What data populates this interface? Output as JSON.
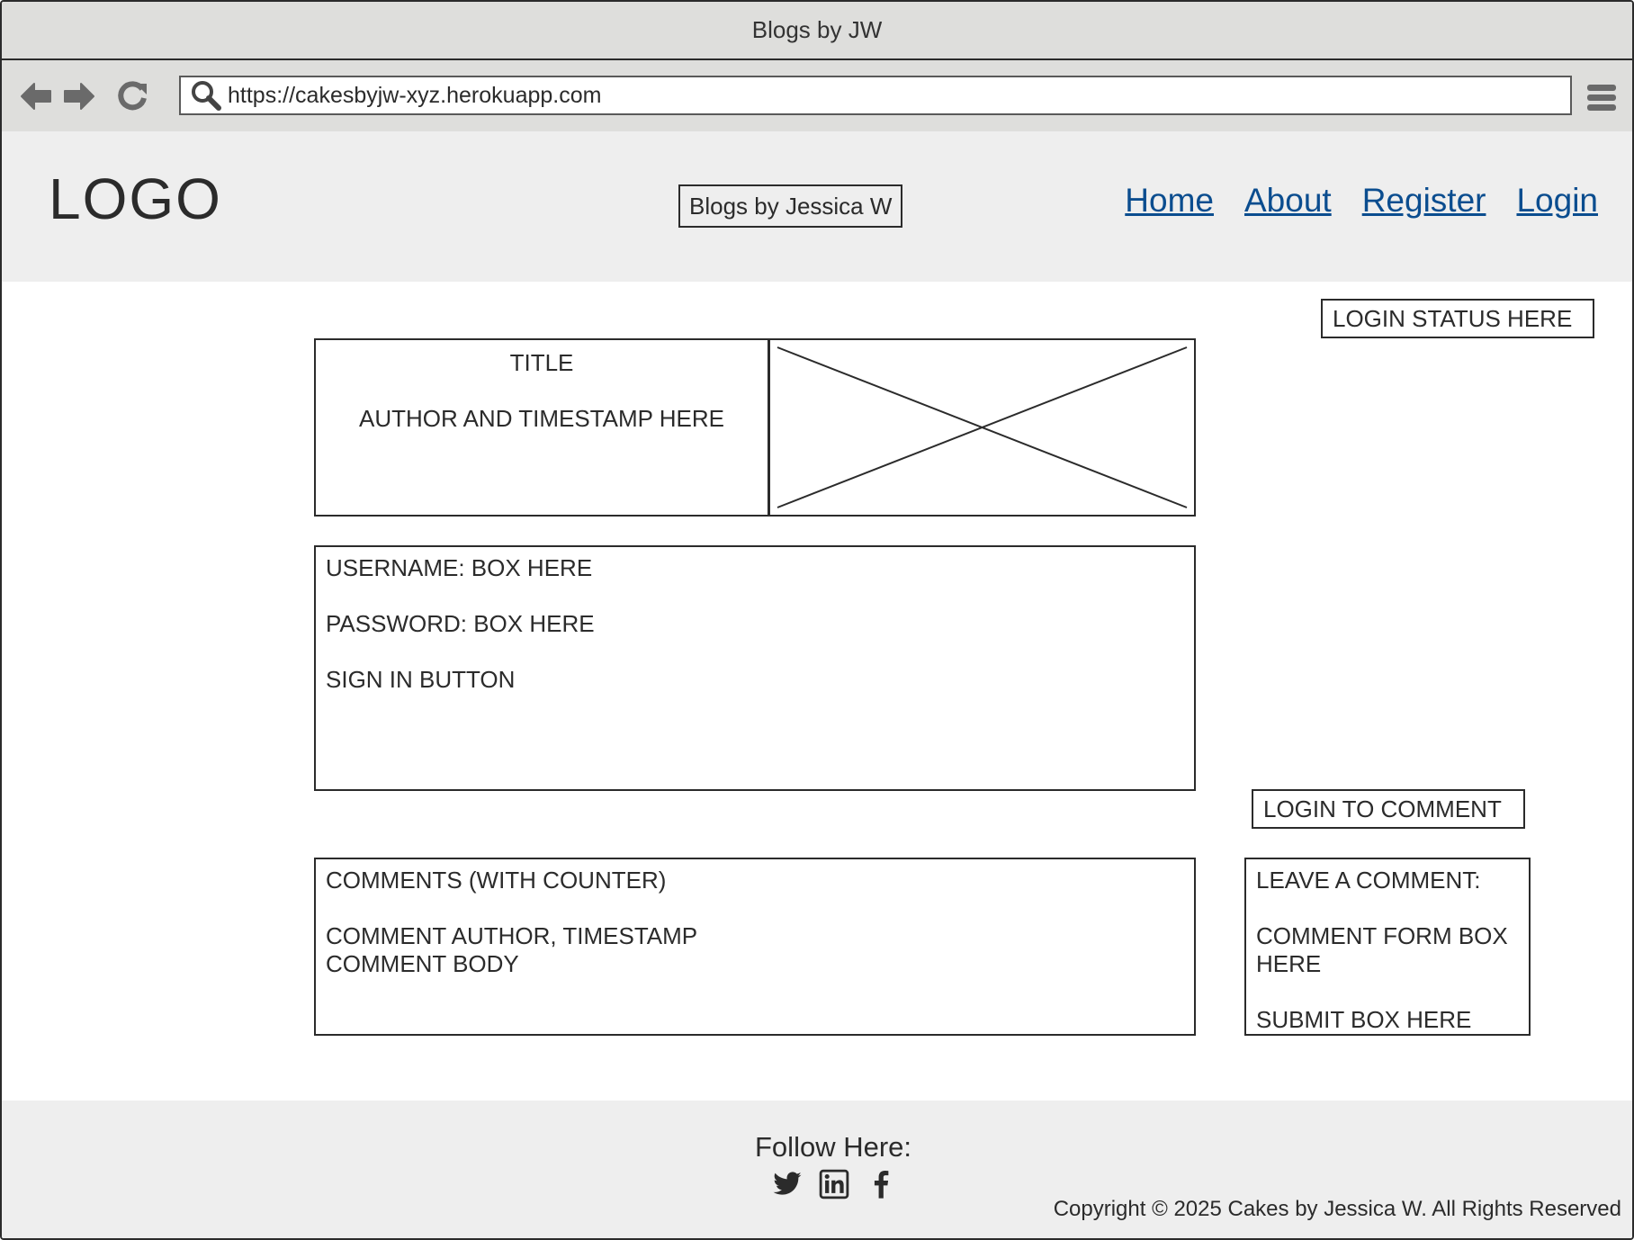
{
  "window": {
    "title": "Blogs by JW"
  },
  "browser": {
    "url": "https://cakesbyjw-xyz.herokuapp.com"
  },
  "header": {
    "logo": "LOGO",
    "brand": "Blogs by Jessica W",
    "nav": [
      {
        "label": "Home"
      },
      {
        "label": "About"
      },
      {
        "label": "Register"
      },
      {
        "label": "Login"
      }
    ]
  },
  "main": {
    "login_status": "LOGIN STATUS HERE",
    "post": {
      "title": "TITLE",
      "meta": "AUTHOR AND TIMESTAMP HERE"
    },
    "login_form": {
      "username": "USERNAME: BOX HERE",
      "password": "PASSWORD: BOX HERE",
      "button": "SIGN IN BUTTON"
    },
    "login_to_comment": "LOGIN TO COMMENT",
    "comments": {
      "heading": "COMMENTS (WITH COUNTER)",
      "author_line": "COMMENT AUTHOR, TIMESTAMP",
      "body_line": "COMMENT BODY"
    },
    "leave_comment": {
      "heading": "LEAVE A COMMENT:",
      "form_line": "COMMENT FORM BOX HERE",
      "submit_line": "SUBMIT BOX HERE"
    }
  },
  "footer": {
    "follow": "Follow Here:",
    "socials": [
      "twitter-icon",
      "linkedin-icon",
      "facebook-icon"
    ],
    "copyright": "Copyright © 2025 Cakes by Jessica W. All Rights Reserved"
  },
  "colors": {
    "link": "#0b4d8f",
    "chrome": "#dededc",
    "header_bg": "#eeeeee"
  }
}
